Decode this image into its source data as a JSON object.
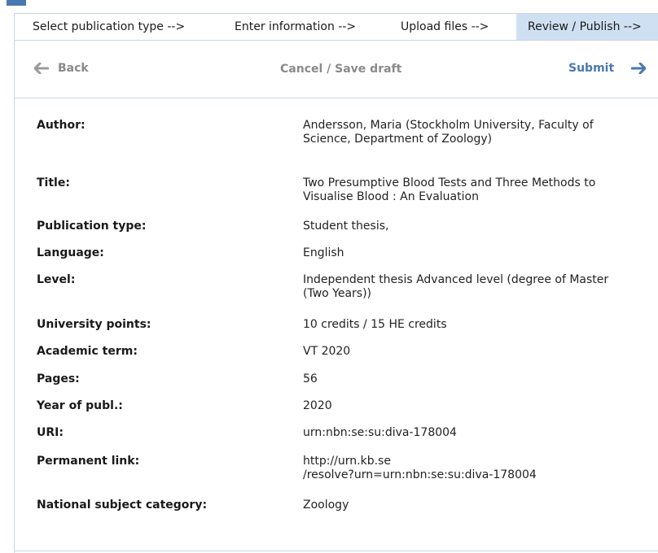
{
  "steps": [
    {
      "label": "Select publication type -->"
    },
    {
      "label": "Enter information -->"
    },
    {
      "label": "Upload files -->"
    },
    {
      "label": "Review / Publish -->"
    }
  ],
  "actions": {
    "back_label": "Back",
    "cancel_label": "Cancel / Save draft",
    "submit_label": "Submit"
  },
  "record": [
    {
      "label": "Author:",
      "value": "Andersson, Maria (Stockholm University, Faculty of Science, Department of Zoology)"
    },
    {
      "label": "Title:",
      "value": "Two Presumptive Blood Tests and Three Methods to Visualise Blood : An Evaluation"
    },
    {
      "label": "Publication type:",
      "value": "Student thesis,"
    },
    {
      "label": "Language:",
      "value": "English"
    },
    {
      "label": "Level:",
      "value": "Independent thesis Advanced level (degree of Master (Two Years))"
    },
    {
      "label": "University points:",
      "value": "10 credits / 15 HE credits"
    },
    {
      "label": "Academic term:",
      "value": "VT 2020"
    },
    {
      "label": "Pages:",
      "value": "56"
    },
    {
      "label": "Year of publ.:",
      "value": "2020"
    },
    {
      "label": "URI:",
      "value": "urn:nbn:se:su:diva-178004"
    },
    {
      "label": "Permanent link:",
      "value": "http://urn.kb.se\n/resolve?urn=urn:nbn:se:su:diva-178004"
    },
    {
      "label": "National subject category:",
      "value": "Zoology"
    }
  ],
  "colors": {
    "accent": "#4a78b0",
    "active_step_bg": "#cfe0f2",
    "border": "#c8d6e5",
    "muted": "#8a8a8a"
  },
  "icons": {
    "back": "arrow-left-icon",
    "submit": "arrow-right-icon"
  }
}
